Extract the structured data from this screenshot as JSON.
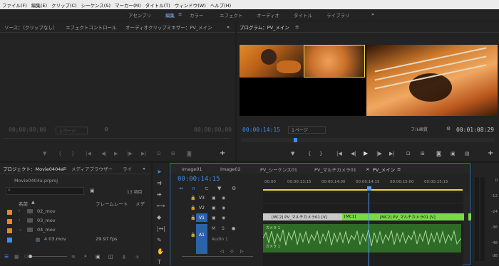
{
  "menu": [
    "ファイル(F)",
    "編集(E)",
    "クリップ(C)",
    "シーケンス(S)",
    "マーカー(M)",
    "タイトル(T)",
    "ウィンドウ(W)",
    "ヘルプ(H)"
  ],
  "workspaces": [
    "アセンブリ",
    "編集",
    "カラー",
    "エフェクト",
    "オーディオ",
    "タイトル",
    "ライブラリ"
  ],
  "workspace_more": "»",
  "source_panel": {
    "tabs": [
      "ソース：（クリップなし）",
      "エフェクトコントロール",
      "オーディオクリップミキサー：PV_メイン"
    ],
    "more": "»",
    "timecode_left": "00;00;00;00",
    "page": "１ページ",
    "timecode_right": "00;00;00;00"
  },
  "program_panel": {
    "title": "プログラム：PV_メイン",
    "timecode": "00:00:14:15",
    "page": "１ページ",
    "quality": "フル画質",
    "duration": "00:01:08:29"
  },
  "project_panel": {
    "tabs": [
      "プロジェクト：Movie0404a",
      "メディアブラウザー",
      "ライ"
    ],
    "more": "»",
    "file": "Movie0404a.prproj",
    "count": "13 項目",
    "columns": [
      "名前",
      "フレームレート",
      "メデ"
    ],
    "items": [
      {
        "name": "02_mov",
        "rate": ""
      },
      {
        "name": "03_mov",
        "rate": ""
      },
      {
        "name": "04_mov",
        "rate": ""
      },
      {
        "name": "4 03.mov",
        "rate": "29.97 fps"
      }
    ]
  },
  "timeline": {
    "tabs": [
      "Image01",
      "Image02",
      "PV_シーケンス01",
      "PV_マルチカメラ01",
      "PV_メイン"
    ],
    "timecode": "00:00:14:15",
    "ruler": [
      "00:00",
      "00:00:13:15",
      "00:00:14:00",
      "00:00:14:15",
      "00:00:15:00",
      "00:00:15:15"
    ],
    "tracks": [
      "V3",
      "V2",
      "V1",
      "A1"
    ],
    "audio_track_name": "Audio 1",
    "clips": [
      "[MC2] PV_マルチカメラ01 [V]",
      "[MC1]",
      "[MC2] PV_マルチカメラ01 [V]"
    ],
    "audio_clip_label": "カメラ 1"
  },
  "meters": [
    "0",
    "-12",
    "-24",
    "-36",
    "-48",
    "dB"
  ],
  "colors": {
    "accent": "#3d8ef3",
    "clip_green": "#7bd84a",
    "audio_green": "#2e6b26",
    "playhead": "#4da0ff"
  }
}
